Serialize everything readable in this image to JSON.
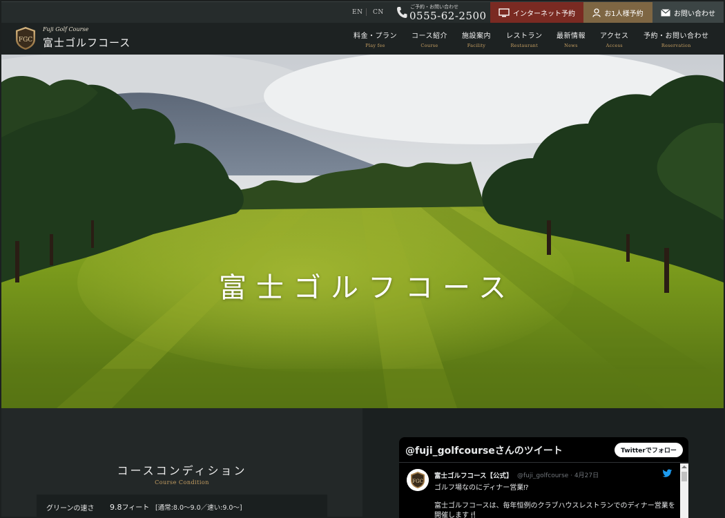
{
  "topbar": {
    "lang_en": "EN",
    "lang_cn": "CN",
    "phone_caption": "ご予約・お問い合わせ",
    "phone_number": "0555-62-2500",
    "internet_booking": "インターネット予約",
    "solo_booking": "お1人様予約",
    "contact": "お問い合わせ",
    "colors": {
      "internet_booking": "#7a2a22",
      "solo_booking": "#7e6643",
      "contact": "#3c4545"
    }
  },
  "header": {
    "logo_badge": "FGC",
    "logo_sub": "Fuji Golf Course",
    "logo_name": "富士ゴルフコース",
    "nav": [
      {
        "jp": "料金・プラン",
        "en": "Play fee"
      },
      {
        "jp": "コース紹介",
        "en": "Course"
      },
      {
        "jp": "施設案内",
        "en": "Facility"
      },
      {
        "jp": "レストラン",
        "en": "Restaurant"
      },
      {
        "jp": "最新情報",
        "en": "News"
      },
      {
        "jp": "アクセス",
        "en": "Access"
      },
      {
        "jp": "予約・お問い合わせ",
        "en": "Reservation"
      }
    ],
    "accent_color": "#c7a063"
  },
  "hero": {
    "title": "富士ゴルフコース"
  },
  "course_condition": {
    "title": "コースコンディション",
    "subtitle": "Course Condition",
    "green_speed_label": "グリーンの速さ",
    "green_speed_value": "9.8",
    "green_speed_unit": "フィート",
    "green_speed_note": "[通常:8.0〜9.0／速い:9.0〜]"
  },
  "twitter": {
    "heading": "@fuji_golfcourseさんのツイート",
    "follow_button": "Twitterでフォロー",
    "avatar_text": "FGC",
    "account_name": "富士ゴルフコース【公式】",
    "handle_date": "@fuji_golfcourse · 4月27日",
    "line1": "ゴルフ場なのにディナー営業⁉",
    "line2": "富士ゴルフコースは、毎年恒例のクラブハウスレストランでのディナー営業を",
    "line3": "開催します🍴",
    "icon": "twitter-bird-icon"
  }
}
